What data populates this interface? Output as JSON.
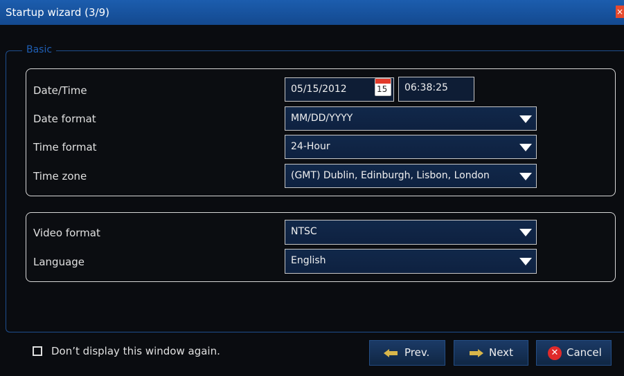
{
  "window": {
    "title": "Startup wizard (3/9)",
    "close_glyph": "×"
  },
  "group": {
    "legend": "Basic"
  },
  "datetime": {
    "label": "Date/Time",
    "date_value": "05/15/2012",
    "calendar_day": "15",
    "time_value": "06:38:25"
  },
  "date_format": {
    "label": "Date format",
    "value": "MM/DD/YYYY"
  },
  "time_format": {
    "label": "Time format",
    "value": "24-Hour"
  },
  "time_zone": {
    "label": "Time zone",
    "value": "(GMT) Dublin, Edinburgh, Lisbon, London"
  },
  "video_format": {
    "label": "Video format",
    "value": "NTSC"
  },
  "language": {
    "label": "Language",
    "value": "English"
  },
  "footer": {
    "checkbox_label": "Don’t display this window again.",
    "prev_label": "Prev.",
    "next_label": "Next",
    "cancel_label": "Cancel"
  },
  "colors": {
    "accent": "#1f5fb5",
    "titlebar": "#1c5dae",
    "cancel": "#e02a2a",
    "arrow": "#d8b64a"
  }
}
